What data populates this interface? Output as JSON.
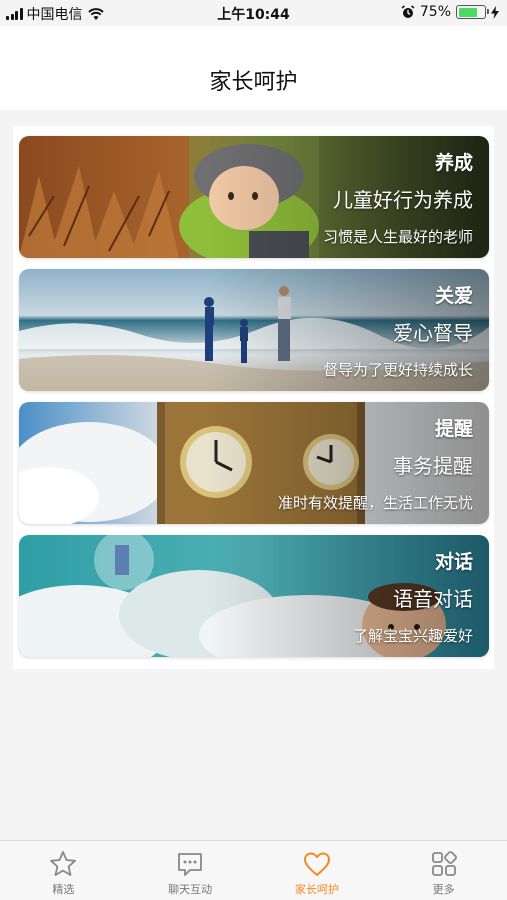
{
  "status_bar": {
    "carrier": "中国电信",
    "time": "上午10:44",
    "battery_percent": "75%",
    "battery_level": 0.75
  },
  "nav": {
    "title": "家长呵护"
  },
  "cards": [
    {
      "title": "养成",
      "subtitle": "儿童好行为养成",
      "caption": "习惯是人生最好的老师"
    },
    {
      "title": "关爱",
      "subtitle": "爱心督导",
      "caption": "督导为了更好持续成长"
    },
    {
      "title": "提醒",
      "subtitle": "事务提醒",
      "caption": "准时有效提醒，生活工作无忧"
    },
    {
      "title": "对话",
      "subtitle": "语音对话",
      "caption": "了解宝宝兴趣爱好"
    }
  ],
  "tabs": [
    {
      "label": "精选",
      "icon": "star-icon"
    },
    {
      "label": "聊天互动",
      "icon": "chat-bubble-icon"
    },
    {
      "label": "家长呵护",
      "icon": "heart-icon",
      "active": true
    },
    {
      "label": "更多",
      "icon": "grid-icon"
    }
  ],
  "colors": {
    "accent": "#f08a24",
    "inactive": "#777777"
  }
}
